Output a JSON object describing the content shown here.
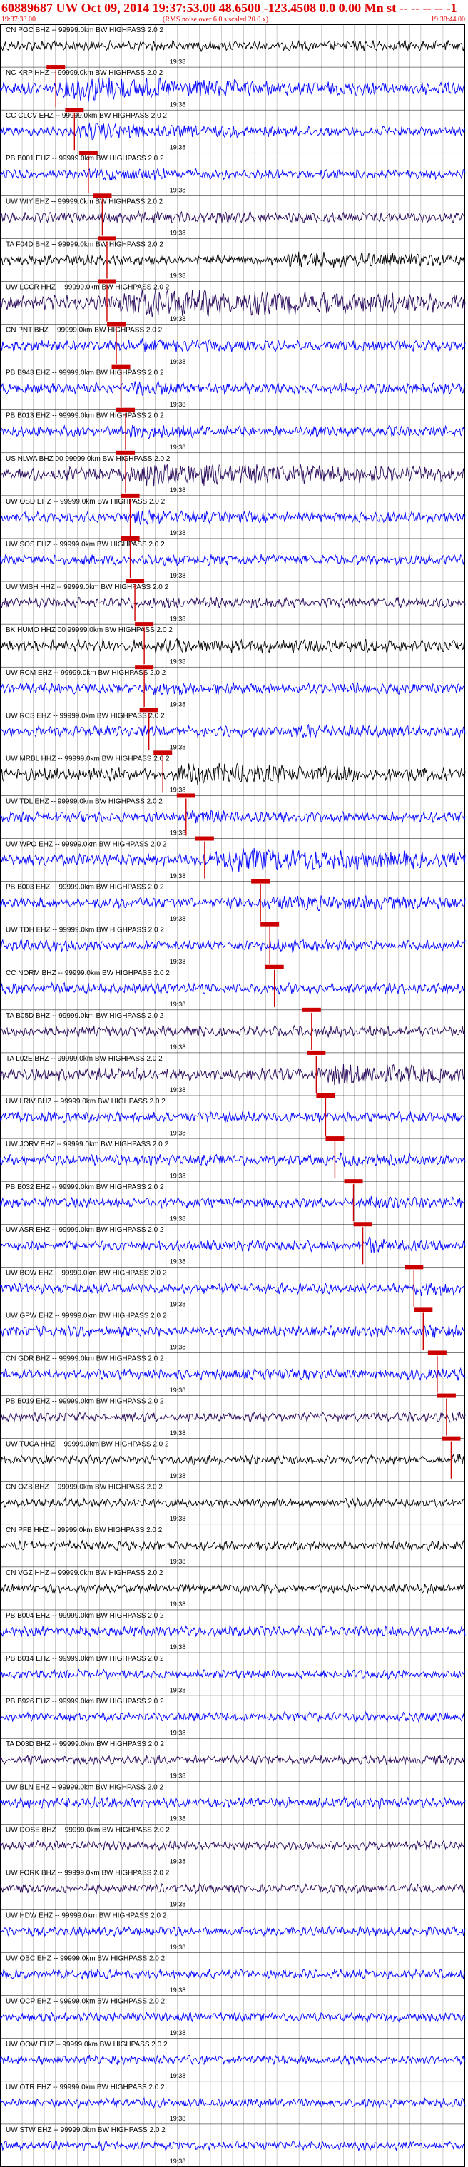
{
  "header": {
    "title": "60889687 UW Oct 09, 2014 19:37:53.00   48.6500 -123.4508  0.0 0.00 Mn st -- -- -- -- -1",
    "start_time": "19:37:33.00",
    "subtitle": "(RMS noise over 6.0 s scaled 20.0 x)",
    "end_time": "19:38:44.00"
  },
  "colors": {
    "header_red": "#e00000",
    "pick_red": "#cc0000",
    "blue": "#0000ff",
    "purple": "#2a0a5a",
    "black": "#000000"
  },
  "chart_data": {
    "type": "line",
    "title": "60889687 UW Oct 09, 2014 19:37:53.00",
    "x_range": [
      "19:37:33.00",
      "19:38:44.00"
    ],
    "x_tick_label": "19:38",
    "grid": true,
    "series": [
      {
        "name": "CN PGC BHZ -- 99999.0km BW  HIGHPASS  2.0  2",
        "color": "#000000",
        "amp": 0.35,
        "pick": null,
        "burst": null
      },
      {
        "name": "NC KRP HHZ -- 99999.0km BW  HIGHPASS  2.0  2",
        "color": "#0000ff",
        "amp": 0.4,
        "pick": 0.12,
        "burst": [
          0.12,
          0.35,
          3.0
        ]
      },
      {
        "name": "CC CLCV EHZ -- 99999.0km BW  HIGHPASS  2.0  2",
        "color": "#0000ff",
        "amp": 0.3,
        "pick": 0.16,
        "burst": [
          0.16,
          0.25,
          2.5
        ]
      },
      {
        "name": "PB B001 EHZ -- 99999.0km BW  HIGHPASS  2.0  2",
        "color": "#0000ff",
        "amp": 0.3,
        "pick": 0.19,
        "burst": [
          0.19,
          0.2,
          2.0
        ]
      },
      {
        "name": "UW WIY EHZ -- 99999.0km BW  HIGHPASS  2.0  2",
        "color": "#2a0a5a",
        "amp": 0.35,
        "pick": 0.22,
        "burst": [
          0.22,
          0.15,
          1.2
        ]
      },
      {
        "name": "TA F04D BHZ -- 99999.0km BW  HIGHPASS  2.0  2",
        "color": "#000000",
        "amp": 0.35,
        "pick": 0.23,
        "burst": [
          0.6,
          0.25,
          2.2
        ]
      },
      {
        "name": "UW LCCR HHZ -- 99999.0km BW  HIGHPASS  2.0  2",
        "color": "#2a0a5a",
        "amp": 0.5,
        "pick": 0.23,
        "burst": [
          0.23,
          0.6,
          2.5
        ]
      },
      {
        "name": "CN PNT BHZ -- 99999.0km BW  HIGHPASS  2.0  2",
        "color": "#0000ff",
        "amp": 0.35,
        "pick": 0.25,
        "burst": [
          0.27,
          0.15,
          1.8
        ]
      },
      {
        "name": "PB B943 EHZ -- 99999.0km BW  HIGHPASS  2.0  2",
        "color": "#0000ff",
        "amp": 0.35,
        "pick": 0.26,
        "burst": [
          0.27,
          0.1,
          2.0
        ]
      },
      {
        "name": "PB B013 EHZ -- 99999.0km BW  HIGHPASS  2.0  2",
        "color": "#0000ff",
        "amp": 0.35,
        "pick": 0.27,
        "burst": [
          0.27,
          0.12,
          1.8
        ]
      },
      {
        "name": "US NLWA BHZ 00 99999.0km BW  HIGHPASS  2.0  2",
        "color": "#2a0a5a",
        "amp": 0.45,
        "pick": 0.27,
        "burst": [
          0.27,
          0.4,
          2.5
        ]
      },
      {
        "name": "UW OSD EHZ -- 99999.0km BW  HIGHPASS  2.0  2",
        "color": "#0000ff",
        "amp": 0.35,
        "pick": 0.28,
        "burst": [
          0.28,
          0.1,
          1.8
        ]
      },
      {
        "name": "UW SOS EHZ -- 99999.0km BW  HIGHPASS  2.0  2",
        "color": "#0000ff",
        "amp": 0.35,
        "pick": 0.28,
        "burst": [
          0.28,
          0.1,
          1.2
        ]
      },
      {
        "name": "UW WISH HHZ -- 99999.0km BW  HIGHPASS  2.0  2",
        "color": "#2a0a5a",
        "amp": 0.35,
        "pick": 0.29,
        "burst": [
          0.29,
          0.15,
          1.2
        ]
      },
      {
        "name": "BK HUMO HHZ 00 99999.0km BW  HIGHPASS  2.0  2",
        "color": "#000000",
        "amp": 0.4,
        "pick": 0.31,
        "burst": [
          0.31,
          0.35,
          1.5
        ]
      },
      {
        "name": "UW RCM EHZ -- 99999.0km BW  HIGHPASS  2.0  2",
        "color": "#0000ff",
        "amp": 0.35,
        "pick": 0.31,
        "burst": [
          0.31,
          0.12,
          1.8
        ]
      },
      {
        "name": "UW RCS EHZ -- 99999.0km BW  HIGHPASS  2.0  2",
        "color": "#0000ff",
        "amp": 0.35,
        "pick": 0.32,
        "burst": [
          0.63,
          0.08,
          2.0
        ]
      },
      {
        "name": "UW MRBL HHZ -- 99999.0km BW  HIGHPASS  2.0  2",
        "color": "#000000",
        "amp": 0.45,
        "pick": 0.35,
        "burst": [
          0.36,
          0.3,
          2.2
        ]
      },
      {
        "name": "UW TDL EHZ -- 99999.0km BW  HIGHPASS  2.0  2",
        "color": "#0000ff",
        "amp": 0.35,
        "pick": 0.4,
        "burst": [
          0.4,
          0.08,
          1.8
        ]
      },
      {
        "name": "UW WPO EHZ -- 99999.0km BW  HIGHPASS  2.0  2",
        "color": "#0000ff",
        "amp": 0.4,
        "pick": 0.44,
        "burst": [
          0.44,
          0.45,
          2.8
        ]
      },
      {
        "name": "PB B003 EHZ -- 99999.0km BW  HIGHPASS  2.0  2",
        "color": "#0000ff",
        "amp": 0.35,
        "pick": 0.56,
        "burst": [
          0.56,
          0.4,
          1.8
        ]
      },
      {
        "name": "UW TDH EHZ -- 99999.0km BW  HIGHPASS  2.0  2",
        "color": "#0000ff",
        "amp": 0.35,
        "pick": 0.58,
        "burst": [
          0.58,
          0.1,
          1.5
        ]
      },
      {
        "name": "CC NORM BHZ -- 99999.0km BW  HIGHPASS  2.0  2",
        "color": "#0000ff",
        "amp": 0.35,
        "pick": 0.59,
        "burst": null
      },
      {
        "name": "TA B05D BHZ -- 99999.0km BW  HIGHPASS  2.0  2",
        "color": "#2a0a5a",
        "amp": 0.35,
        "pick": 0.67,
        "burst": [
          0.67,
          0.15,
          1.2
        ]
      },
      {
        "name": "TA L02E BHZ -- 99999.0km BW  HIGHPASS  2.0  2",
        "color": "#2a0a5a",
        "amp": 0.4,
        "pick": 0.68,
        "burst": [
          0.68,
          0.3,
          2.5
        ]
      },
      {
        "name": "UW LRIV BHZ -- 99999.0km BW  HIGHPASS  2.0  2",
        "color": "#0000ff",
        "amp": 0.35,
        "pick": 0.7,
        "burst": null
      },
      {
        "name": "UW JORV EHZ -- 99999.0km BW  HIGHPASS  2.0  2",
        "color": "#0000ff",
        "amp": 0.35,
        "pick": 0.72,
        "burst": [
          0.72,
          0.1,
          1.5
        ]
      },
      {
        "name": "PB B032 EHZ -- 99999.0km BW  HIGHPASS  2.0  2",
        "color": "#0000ff",
        "amp": 0.35,
        "pick": 0.76,
        "burst": [
          0.76,
          0.1,
          1.8
        ]
      },
      {
        "name": "UW ASR EHZ -- 99999.0km BW  HIGHPASS  2.0  2",
        "color": "#0000ff",
        "amp": 0.35,
        "pick": 0.78,
        "burst": [
          0.78,
          0.05,
          2.5
        ]
      },
      {
        "name": "UW BOW EHZ -- 99999.0km BW  HIGHPASS  2.0  2",
        "color": "#0000ff",
        "amp": 0.35,
        "pick": 0.89,
        "burst": [
          0.89,
          0.1,
          1.8
        ]
      },
      {
        "name": "UW GPW EHZ -- 99999.0km BW  HIGHPASS  2.0  2",
        "color": "#0000ff",
        "amp": 0.35,
        "pick": 0.91,
        "burst": [
          0.91,
          0.1,
          1.5
        ]
      },
      {
        "name": "CN GDR BHZ -- 99999.0km BW  HIGHPASS  2.0  2",
        "color": "#0000ff",
        "amp": 0.35,
        "pick": 0.94,
        "burst": [
          0.93,
          0.07,
          1.5
        ]
      },
      {
        "name": "PB B019 EHZ -- 99999.0km BW  HIGHPASS  2.0  2",
        "color": "#2a0a5a",
        "amp": 0.3,
        "pick": 0.96,
        "burst": [
          0.96,
          0.04,
          1.8
        ]
      },
      {
        "name": "UW TUCA HHZ -- 99999.0km BW  HIGHPASS  2.0  2",
        "color": "#000000",
        "amp": 0.3,
        "pick": 0.97,
        "burst": [
          0.97,
          0.03,
          2.0
        ]
      },
      {
        "name": "CN OZB BHZ -- 99999.0km BW  HIGHPASS  2.0  2",
        "color": "#000000",
        "amp": 0.3,
        "pick": null,
        "burst": null
      },
      {
        "name": "CN PFB HHZ -- 99999.0km BW  HIGHPASS  2.0  2",
        "color": "#000000",
        "amp": 0.3,
        "pick": null,
        "burst": null
      },
      {
        "name": "CN VGZ HHZ -- 99999.0km BW  HIGHPASS  2.0  2",
        "color": "#000000",
        "amp": 0.3,
        "pick": null,
        "burst": null
      },
      {
        "name": "PB B004 EHZ -- 99999.0km BW  HIGHPASS  2.0  2",
        "color": "#0000ff",
        "amp": 0.35,
        "pick": null,
        "burst": null
      },
      {
        "name": "PB B014 EHZ -- 99999.0km BW  HIGHPASS  2.0  2",
        "color": "#0000ff",
        "amp": 0.3,
        "pick": null,
        "burst": null
      },
      {
        "name": "PB B926 EHZ -- 99999.0km BW  HIGHPASS  2.0  2",
        "color": "#0000ff",
        "amp": 0.3,
        "pick": null,
        "burst": null
      },
      {
        "name": "TA D03D BHZ -- 99999.0km BW  HIGHPASS  2.0  2",
        "color": "#2a0a5a",
        "amp": 0.3,
        "pick": null,
        "burst": [
          0.9,
          0.03,
          1.5
        ]
      },
      {
        "name": "UW BLN EHZ -- 99999.0km BW  HIGHPASS  2.0  2",
        "color": "#0000ff",
        "amp": 0.35,
        "pick": null,
        "burst": null
      },
      {
        "name": "UW DOSE BHZ -- 99999.0km BW  HIGHPASS  2.0  2",
        "color": "#2a0a5a",
        "amp": 0.3,
        "pick": null,
        "burst": null
      },
      {
        "name": "UW FORK BHZ -- 99999.0km BW  HIGHPASS  2.0  2",
        "color": "#2a0a5a",
        "amp": 0.3,
        "pick": null,
        "burst": null
      },
      {
        "name": "UW HDW EHZ -- 99999.0km BW  HIGHPASS  2.0  2",
        "color": "#0000ff",
        "amp": 0.3,
        "pick": null,
        "burst": null
      },
      {
        "name": "UW OBC EHZ -- 99999.0km BW  HIGHPASS  2.0  2",
        "color": "#0000ff",
        "amp": 0.3,
        "pick": null,
        "burst": null
      },
      {
        "name": "UW OCP EHZ -- 99999.0km BW  HIGHPASS  2.0  2",
        "color": "#0000ff",
        "amp": 0.3,
        "pick": null,
        "burst": null
      },
      {
        "name": "UW OOW EHZ -- 99999.0km BW  HIGHPASS  2.0  2",
        "color": "#0000ff",
        "amp": 0.3,
        "pick": null,
        "burst": null
      },
      {
        "name": "UW OTR EHZ -- 99999.0km BW  HIGHPASS  2.0  2",
        "color": "#0000ff",
        "amp": 0.3,
        "pick": null,
        "burst": null
      },
      {
        "name": "UW STW EHZ -- 99999.0km BW  HIGHPASS  2.0  2",
        "color": "#0000ff",
        "amp": 0.3,
        "pick": null,
        "burst": null
      }
    ]
  }
}
